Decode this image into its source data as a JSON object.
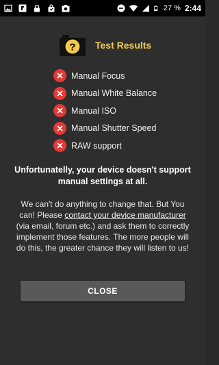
{
  "status_bar": {
    "time": "2:44",
    "battery_text": "27 %",
    "left_icons": [
      "gallery-icon",
      "flipboard-icon",
      "lock-icon",
      "bag-icon",
      "camera-icon"
    ],
    "right_icons": [
      "minus-circle-icon",
      "wifi-icon",
      "signal-icon",
      "battery-icon"
    ]
  },
  "dialog": {
    "title": "Test Results",
    "results": [
      {
        "label": "Manual Focus",
        "status": "unsupported"
      },
      {
        "label": "Manual White Balance",
        "status": "unsupported"
      },
      {
        "label": "Manual ISO",
        "status": "unsupported"
      },
      {
        "label": "Manual Shutter Speed",
        "status": "unsupported"
      },
      {
        "label": "RAW support",
        "status": "unsupported"
      }
    ],
    "warning": "Unfortunatelly, your device doesn't support manual settings at all.",
    "message_before_link": "We can't do anything to change that. But You can! Please ",
    "link_text": "contact your device manufacturer",
    "message_after_link": " (via email, forum etc.) and ask them to correctly implement those features. The more people will do this, the greater chance they will listen to us!",
    "close_label": "CLOSE"
  },
  "colors": {
    "background": "#2e2e2e",
    "title": "#f2c94c",
    "error": "#e53935",
    "button": "#595959"
  }
}
